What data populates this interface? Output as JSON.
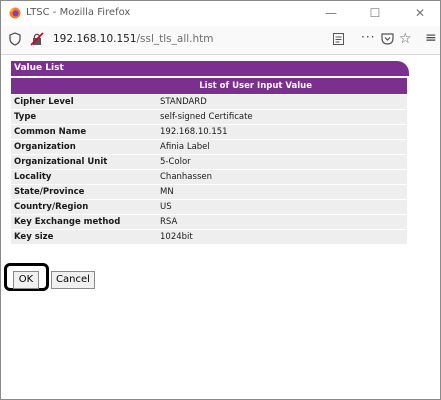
{
  "window": {
    "title": "LTSC - Mozilla Firefox",
    "min_glyph": "—",
    "max_glyph": "☐",
    "close_glyph": "✕"
  },
  "urlbar": {
    "host": "192.168.10.151",
    "path": "/ssl_tls_all.htm",
    "more_glyph": "···",
    "star_glyph": "☆",
    "menu_glyph": "≡"
  },
  "panel": {
    "title": "Value List",
    "caption": "List of User Input Value",
    "rows": [
      {
        "label": "Cipher Level",
        "value": "STANDARD"
      },
      {
        "label": "Type",
        "value": "self-signed Certificate"
      },
      {
        "label": "Common Name",
        "value": "192.168.10.151"
      },
      {
        "label": "Organization",
        "value": "Afinia Label"
      },
      {
        "label": "Organizational Unit",
        "value": "5-Color"
      },
      {
        "label": "Locality",
        "value": "Chanhassen"
      },
      {
        "label": "State/Province",
        "value": "MN"
      },
      {
        "label": "Country/Region",
        "value": "US"
      },
      {
        "label": "Key Exchange method",
        "value": "RSA"
      },
      {
        "label": "Key size",
        "value": "1024bit"
      }
    ]
  },
  "buttons": {
    "ok": "OK",
    "cancel": "Cancel"
  },
  "colors": {
    "accent": "#7b2f8e",
    "row_bg": "#eeeeee",
    "highlight": "#000000"
  }
}
